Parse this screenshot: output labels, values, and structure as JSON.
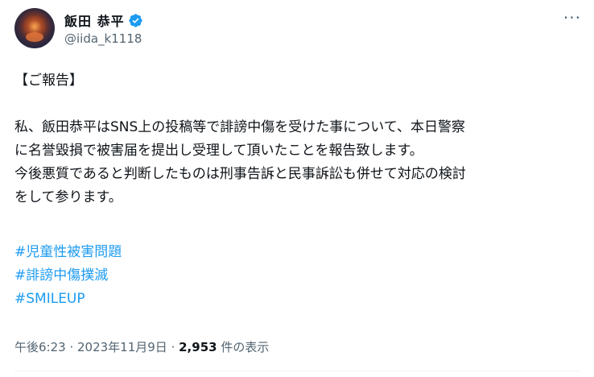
{
  "author": {
    "display_name": "飯田 恭平",
    "handle": "@iida_k1118"
  },
  "menu_icon_label": "···",
  "tweet": {
    "lines": [
      "【ご報告】",
      "",
      "私、飯田恭平はSNS上の投稿等で誹謗中傷を受けた事について、本日警察",
      "に名誉毀損で被害届を提出し受理して頂いたことを報告致します。",
      "今後悪質であると判断したものは刑事告訴と民事訴訟も併せて対応の検討",
      "をして参ります。",
      ""
    ],
    "hashtags": [
      "#児童性被害問題",
      "#誹謗中傷撲滅",
      "#SMILEUP"
    ]
  },
  "meta": {
    "time": "午後6:23",
    "separator": " · ",
    "date": "2023年11月9日",
    "view_count": "2,953",
    "view_suffix": " 件の表示"
  },
  "colors": {
    "verified": "#1d9bf0",
    "hashtag": "#1d9bf0",
    "secondary_text": "#536471"
  }
}
